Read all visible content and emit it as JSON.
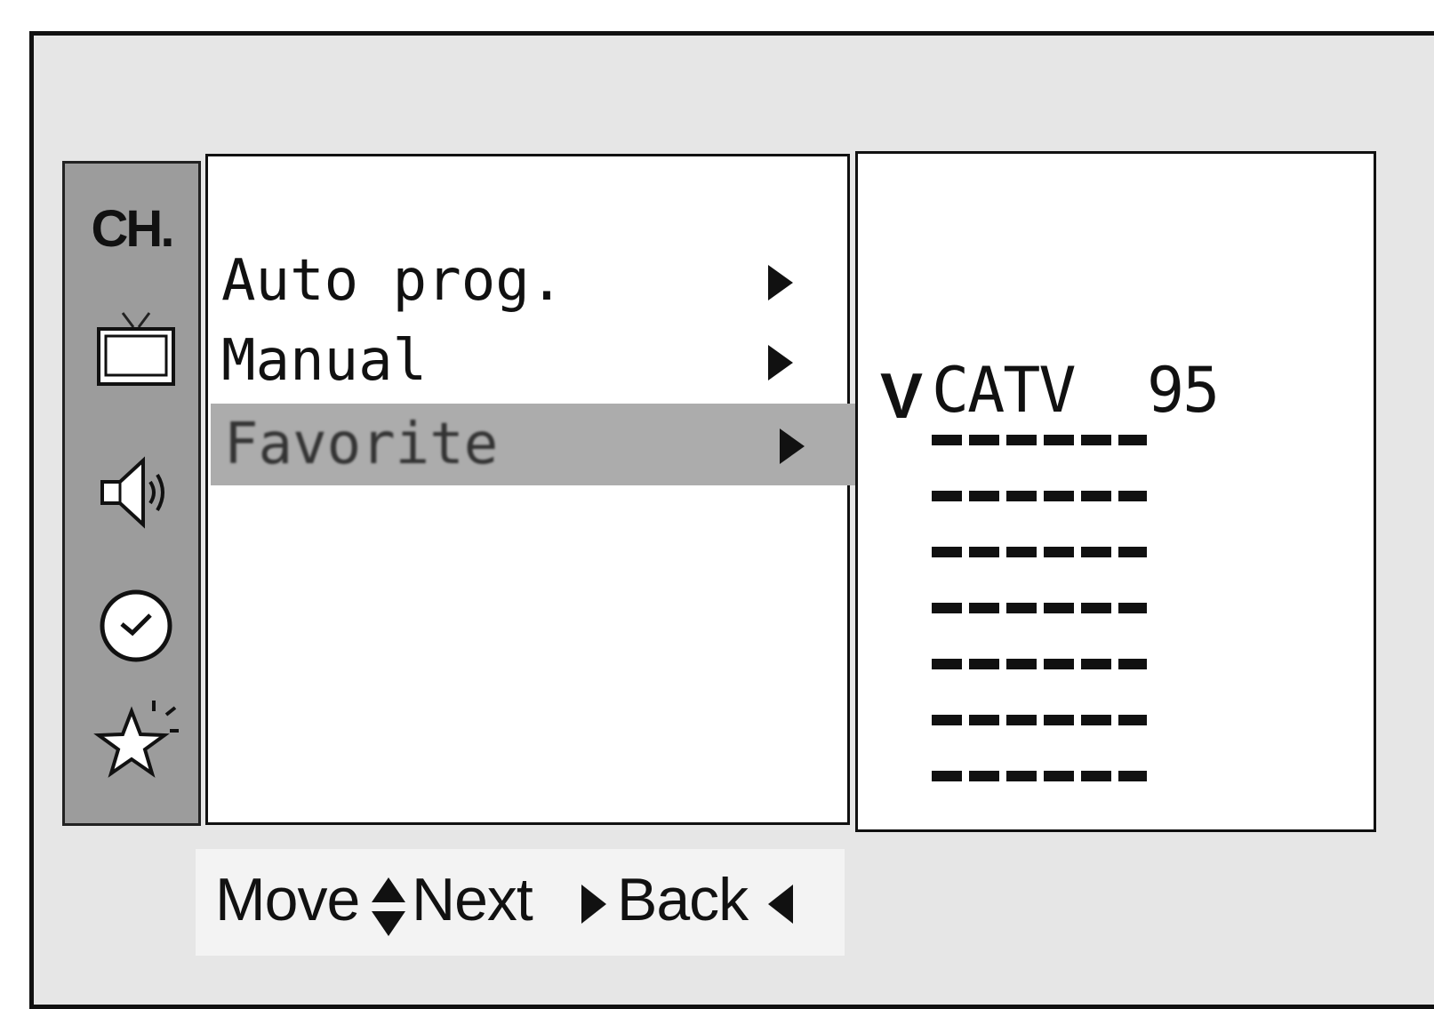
{
  "sidebar": {
    "title": "CH.",
    "icons": [
      "tv-icon",
      "speaker-icon",
      "clock-icon",
      "star-icon"
    ]
  },
  "menu": {
    "items": [
      {
        "label": "Auto prog.",
        "selected": false
      },
      {
        "label": "Manual",
        "selected": false
      },
      {
        "label": "Favorite",
        "selected": true
      }
    ]
  },
  "favorites": {
    "checked_mark": "V",
    "entries": [
      {
        "name": "CATV",
        "number": "95"
      },
      {
        "name": "-----",
        "number": ""
      },
      {
        "name": "-----",
        "number": ""
      },
      {
        "name": "-----",
        "number": ""
      },
      {
        "name": "-----",
        "number": ""
      },
      {
        "name": "-----",
        "number": ""
      },
      {
        "name": "-----",
        "number": ""
      },
      {
        "name": "-----",
        "number": ""
      }
    ]
  },
  "footer": {
    "move_label": "Move",
    "next_label": "Next",
    "back_label": "Back"
  }
}
